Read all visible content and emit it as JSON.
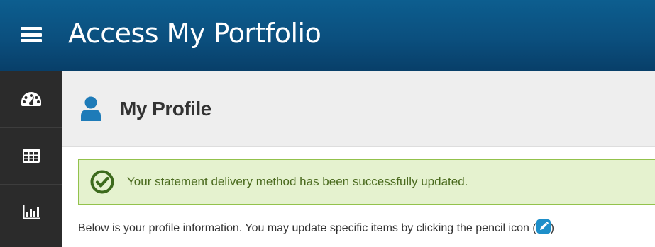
{
  "header": {
    "menu_icon": "hamburger-menu-icon",
    "title": "Access My Portfolio",
    "background_color": "#0b4f7e"
  },
  "sidebar": {
    "background_color": "#2b2b2b",
    "items": [
      {
        "icon": "dashboard-gauge-icon"
      },
      {
        "icon": "table-grid-icon"
      },
      {
        "icon": "bar-chart-icon"
      }
    ]
  },
  "page": {
    "title": "My Profile",
    "title_icon": "user-icon",
    "title_icon_color": "#1e7bb8"
  },
  "alert": {
    "icon": "check-circle-icon",
    "message": "Your statement delivery method has been successfully updated.",
    "background_color": "#e5f2cf",
    "border_color": "#93c24c"
  },
  "info": {
    "text": "Below is your profile information. You may update specific items by clicking the pencil icon (",
    "pencil_icon": "pencil-edit-icon",
    "closing": ")"
  }
}
